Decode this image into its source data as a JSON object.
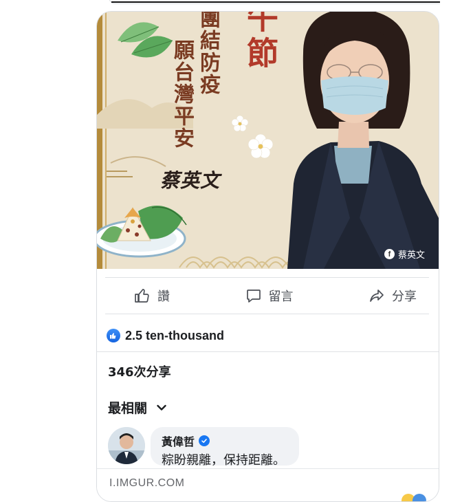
{
  "post_image": {
    "title_text": "午節",
    "line_right": "團結防疫",
    "line_left": "願台灣平安",
    "signature": "蔡英文",
    "watermark": "蔡英文"
  },
  "actions": [
    {
      "label": "讚",
      "icon": "thumbs-up-icon"
    },
    {
      "label": "留言",
      "icon": "comment-icon"
    },
    {
      "label": "分享",
      "icon": "share-icon"
    }
  ],
  "reactions": {
    "count_text": "2.5 ten-thousand",
    "icon": "like-badge-icon"
  },
  "shares_text": "346次分享",
  "sort_label": "最相關",
  "comment": {
    "author": "黃偉哲",
    "text": "粽盼親離，保持距離。"
  },
  "source": {
    "domain": "I.IMGUR.COM"
  },
  "colors": {
    "accent": "#1877f2",
    "image_bg": "#ece2cd",
    "title_red": "#b23a2a",
    "text_secondary": "#4b4f56"
  }
}
